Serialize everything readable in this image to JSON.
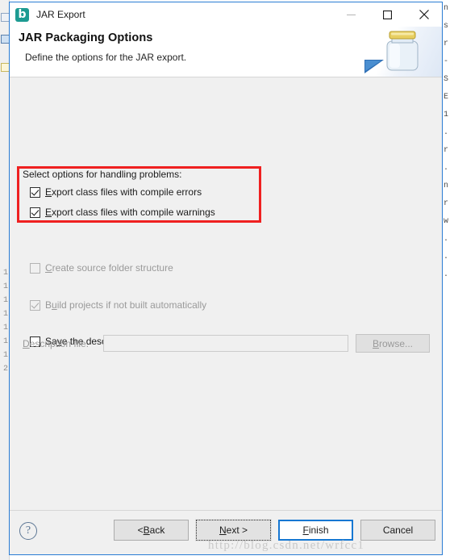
{
  "window": {
    "title": "JAR Export",
    "app_icon": "eclipse-b-icon",
    "minimize_label": "Minimize",
    "maximize_label": "Maximize",
    "close_label": "Close",
    "border_color": "#2a7cd4"
  },
  "header": {
    "title": "JAR Packaging Options",
    "subtitle": "Define the options for the JAR export.",
    "art_icon": "jar-wizard-banner-icon"
  },
  "content": {
    "group_label": "Select options for handling problems:",
    "highlight": {
      "name": "red-annotation-rectangle",
      "color": "#ef2020"
    },
    "options": [
      {
        "id": "export-class-files-compile-errors",
        "label_pre": "",
        "label_mnemonic": "E",
        "label_post": "xport class files with compile errors",
        "checked": true,
        "enabled": true
      },
      {
        "id": "export-class-files-compile-warnings",
        "label_pre": "",
        "label_mnemonic": "E",
        "label_post": "xport class files with compile warnings",
        "checked": true,
        "enabled": true
      },
      {
        "id": "create-source-folder-structure",
        "label_pre": "",
        "label_mnemonic": "C",
        "label_post": "reate source folder structure",
        "checked": false,
        "enabled": false
      },
      {
        "id": "build-projects-if-not-built-automatically",
        "label_pre": "B",
        "label_mnemonic": "u",
        "label_post": "ild projects if not built automatically",
        "checked": true,
        "enabled": false
      },
      {
        "id": "save-description-of-jar-in-workspace",
        "label_pre": "Sa",
        "label_mnemonic": "v",
        "label_post": "e the description of this JAR in the workspace",
        "checked": false,
        "enabled": true
      }
    ],
    "description_file": {
      "label_mnemonic": "D",
      "label_post": "escription file:",
      "value": "",
      "placeholder": "",
      "enabled": false,
      "browse_pre": "B",
      "browse_mnemonic": "r",
      "browse_post": "owse..."
    }
  },
  "footer": {
    "help_glyph": "?",
    "buttons": [
      {
        "id": "back",
        "pre": "< ",
        "mnemonic": "B",
        "post": "ack",
        "state": "normal"
      },
      {
        "id": "next",
        "pre": "",
        "mnemonic": "N",
        "post": "ext >",
        "state": "focused"
      },
      {
        "id": "finish",
        "pre": "",
        "mnemonic": "F",
        "post": "inish",
        "state": "default"
      },
      {
        "id": "cancel",
        "pre": "Cancel",
        "mnemonic": "",
        "post": "",
        "state": "normal"
      }
    ]
  },
  "watermark": {
    "text": "http://blog.csdn.net/wrfcc1"
  },
  "backdrop": {
    "ruler_lines": [
      "1",
      "1",
      "1",
      "1",
      "1",
      "1",
      "1",
      "2"
    ],
    "right_code_fragments": [
      "n",
      "s",
      "r",
      "-",
      "S",
      "E",
      "1",
      ".",
      "r",
      ".",
      "n",
      "r",
      "w",
      ".",
      ".",
      "."
    ]
  }
}
